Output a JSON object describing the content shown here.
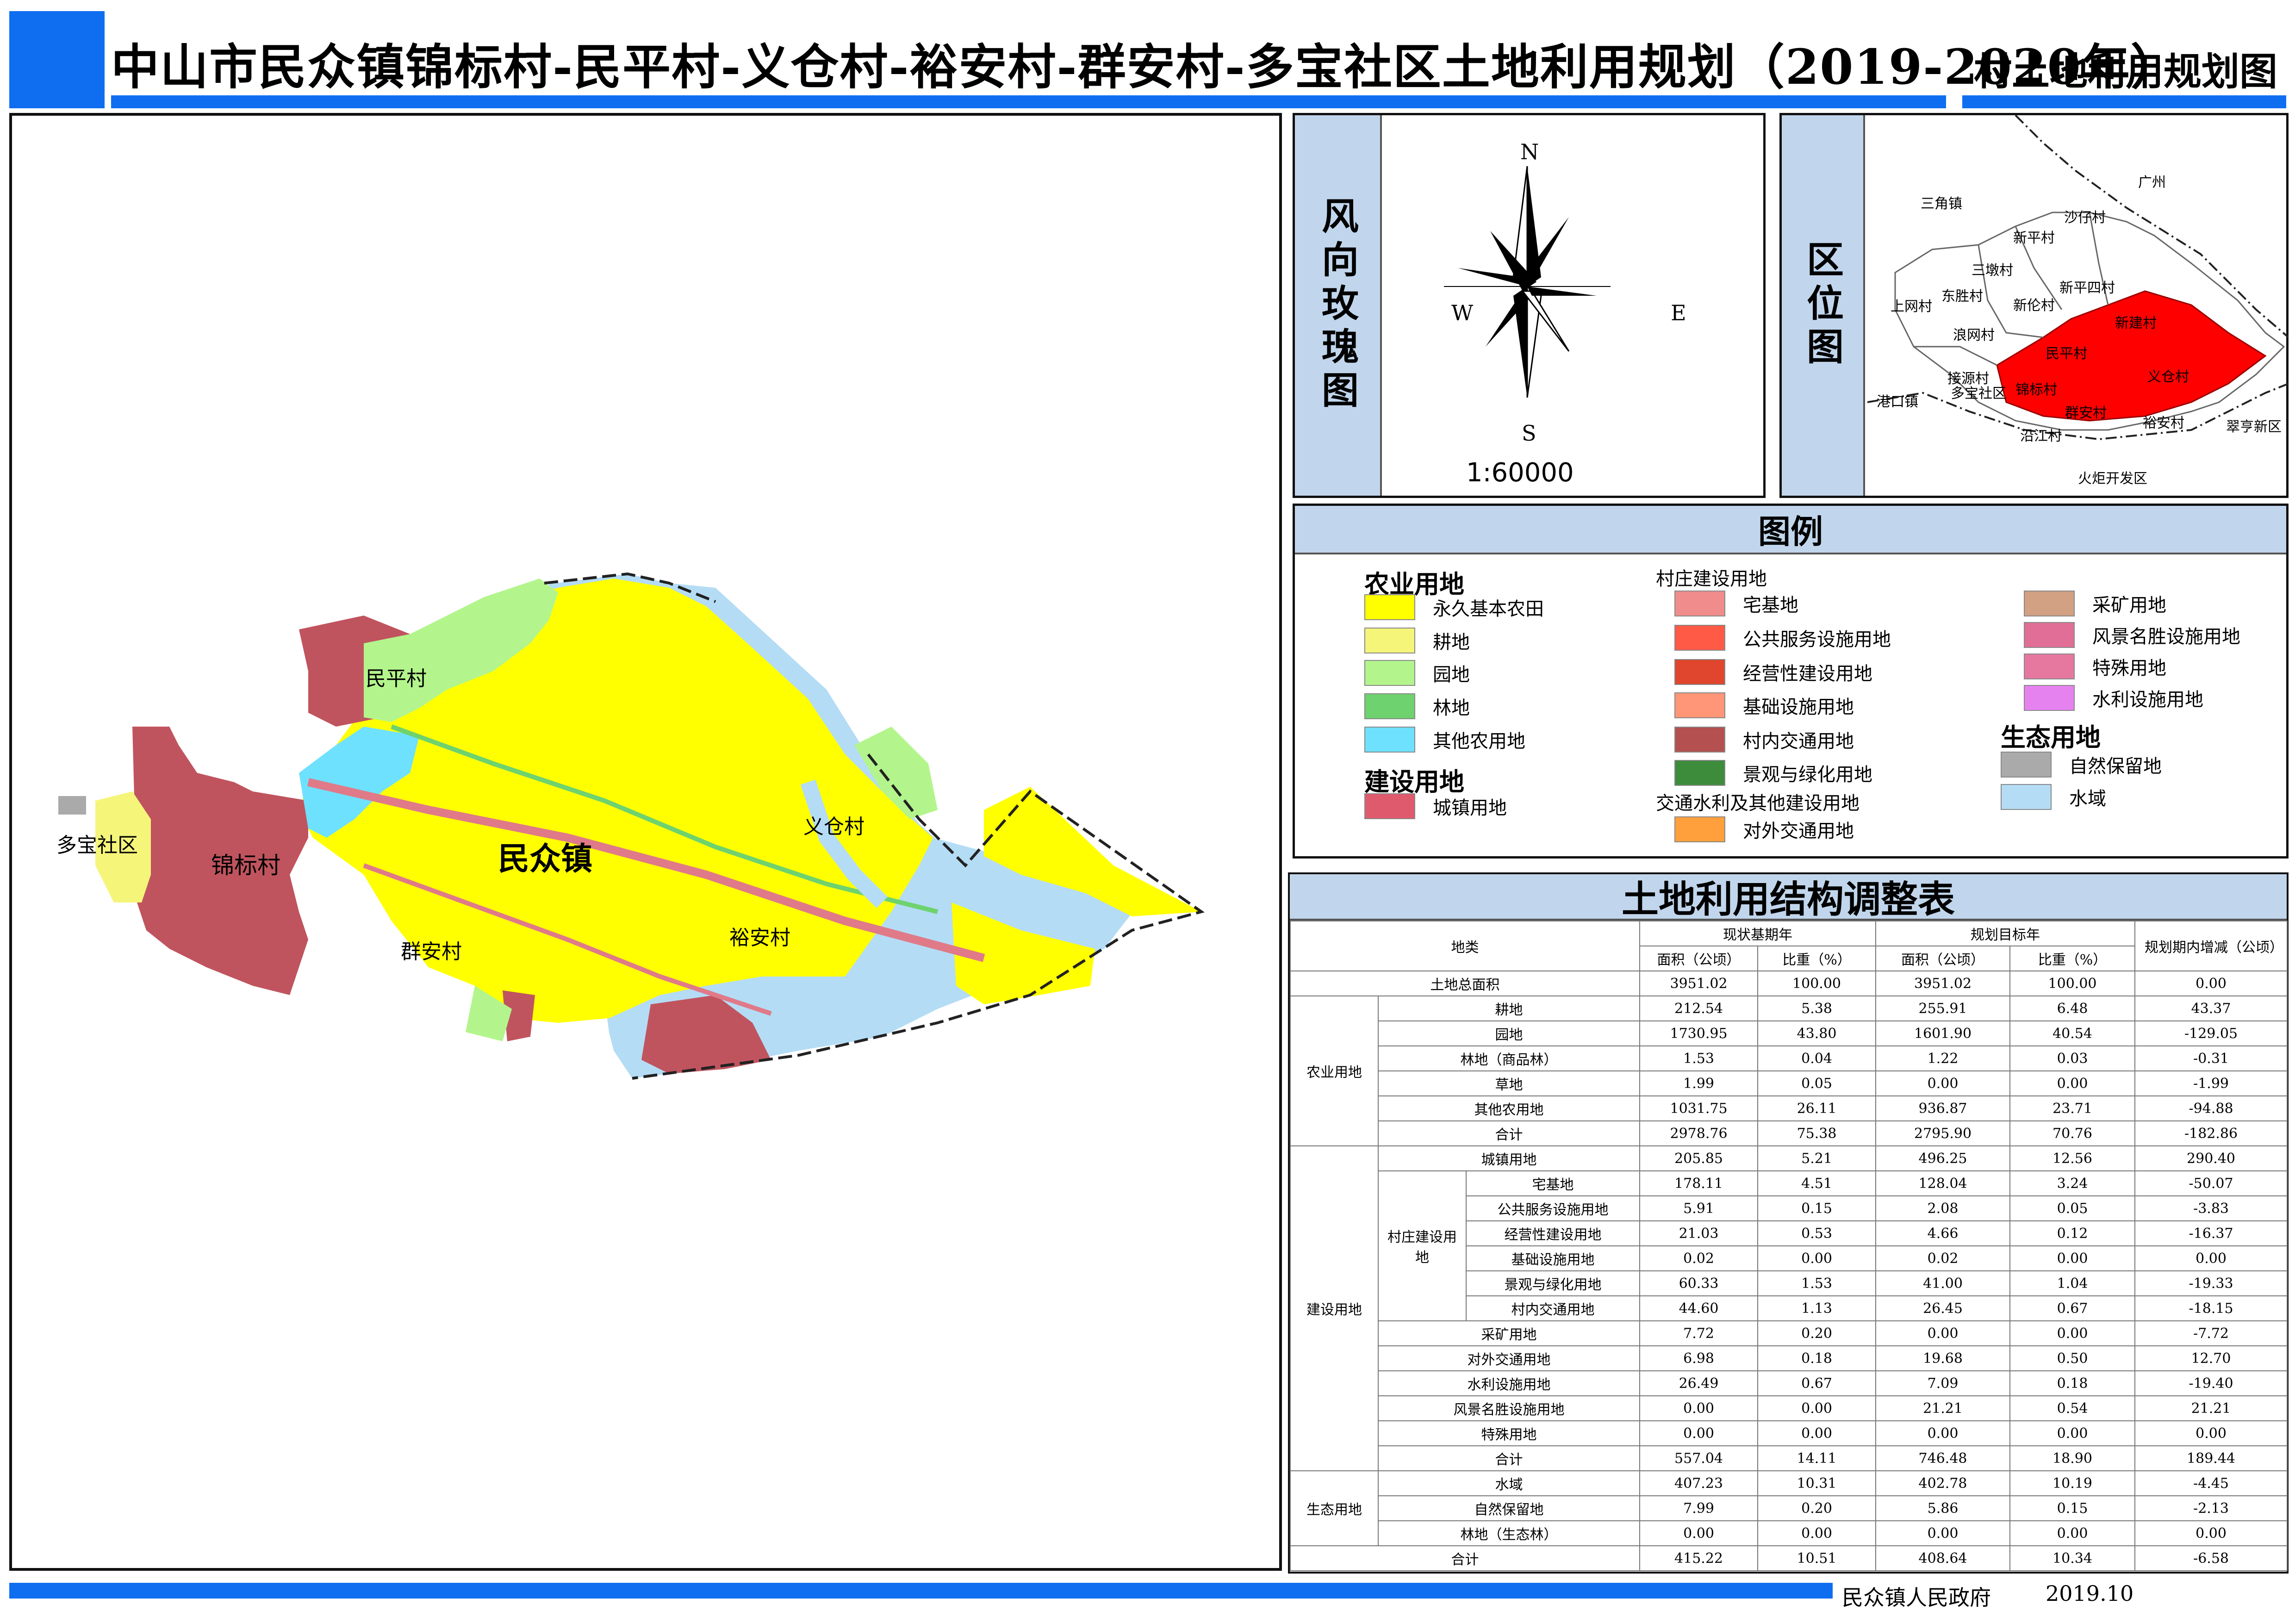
{
  "title": {
    "main": "中山市民众镇锦标村-民平村-义仓村-裕安村-群安村-多宝社区土地利用规划（2019-2020年）",
    "side": "村土地利用规划图"
  },
  "map": {
    "labels": {
      "minping": "民平村",
      "duobao": "多宝社区",
      "jinbiao": "锦标村",
      "minzhong": "民众镇",
      "yicang": "义仓村",
      "qunan": "群安村",
      "yuan": "裕安村"
    }
  },
  "compass": {
    "label": "风向玫瑰图",
    "n": "N",
    "s": "S",
    "e": "E",
    "w": "W",
    "scale": "1:60000"
  },
  "location": {
    "label": "区位图",
    "places": {
      "guangzhou": "广州",
      "sanjiao": "三角镇",
      "shazai": "沙仔村",
      "xinping": "新平村",
      "sandun": "三墩村",
      "xinpingsi": "新平四村",
      "dongsheng": "东胜村",
      "shangwang": "上网村",
      "xinlun": "新伦村",
      "xinjian": "新建村",
      "langwang": "浪网村",
      "minping": "民平村",
      "yicang": "义仓村",
      "jieyuan": "接源村",
      "duobao": "多宝社区",
      "jinbiao": "锦标村",
      "gangkou": "港口镇",
      "qunan": "群安村",
      "yuan": "裕安村",
      "cuiheng": "翠亨新区",
      "yanjiang": "沿江村",
      "huoju": "火炬开发区"
    },
    "colors": {
      "highlight": "#ff0000"
    }
  },
  "legend": {
    "title": "图例",
    "groups": {
      "agri": "农业用地",
      "village": "村庄建设用地",
      "construction": "建设用地",
      "transport": "交通水利及其他建设用地",
      "eco": "生态用地"
    },
    "items": {
      "basic_farm": {
        "label": "永久基本农田",
        "color": "#ffff00"
      },
      "farmland": {
        "label": "耕地",
        "color": "#f5f57a"
      },
      "garden": {
        "label": "园地",
        "color": "#b3f58c"
      },
      "forest": {
        "label": "林地",
        "color": "#6ed26e"
      },
      "other_agri": {
        "label": "其他农用地",
        "color": "#6ee1ff"
      },
      "urban": {
        "label": "城镇用地",
        "color": "#e05a6e"
      },
      "homestead": {
        "label": "宅基地",
        "color": "#f08c8c"
      },
      "public": {
        "label": "公共服务设施用地",
        "color": "#ff5a46"
      },
      "business": {
        "label": "经营性建设用地",
        "color": "#e0462d"
      },
      "infra": {
        "label": "基础设施用地",
        "color": "#ff9678"
      },
      "village_road": {
        "label": "村内交通用地",
        "color": "#b45050"
      },
      "landscape": {
        "label": "景观与绿化用地",
        "color": "#3c8c3c"
      },
      "external": {
        "label": "对外交通用地",
        "color": "#ffa03c"
      },
      "mining": {
        "label": "采矿用地",
        "color": "#d2a082"
      },
      "scenic": {
        "label": "风景名胜设施用地",
        "color": "#e16e96"
      },
      "special": {
        "label": "特殊用地",
        "color": "#e678a0"
      },
      "water_fac": {
        "label": "水利设施用地",
        "color": "#e682f0"
      },
      "reserve": {
        "label": "自然保留地",
        "color": "#aaaaaa"
      },
      "water": {
        "label": "水域",
        "color": "#b4dcf5"
      }
    }
  },
  "table": {
    "title": "土地利用结构调整表",
    "headers": {
      "category": "地类",
      "current": "现状基期年",
      "target": "规划目标年",
      "change": "规划期内增减（公顷）",
      "area": "面积（公顷）",
      "ratio": "比重（%）"
    },
    "groups": {
      "agri": "农业用地",
      "construction": "建设用地",
      "village": "村庄建设用地",
      "eco": "生态用地"
    },
    "rows": [
      [
        "土地总面积",
        "3951.02",
        "100.00",
        "3951.02",
        "100.00",
        "0.00"
      ],
      [
        "耕地",
        "212.54",
        "5.38",
        "255.91",
        "6.48",
        "43.37"
      ],
      [
        "园地",
        "1730.95",
        "43.80",
        "1601.90",
        "40.54",
        "-129.05"
      ],
      [
        "林地（商品林）",
        "1.53",
        "0.04",
        "1.22",
        "0.03",
        "-0.31"
      ],
      [
        "草地",
        "1.99",
        "0.05",
        "0.00",
        "0.00",
        "-1.99"
      ],
      [
        "其他农用地",
        "1031.75",
        "26.11",
        "936.87",
        "23.71",
        "-94.88"
      ],
      [
        "合计",
        "2978.76",
        "75.38",
        "2795.90",
        "70.76",
        "-182.86"
      ],
      [
        "城镇用地",
        "205.85",
        "5.21",
        "496.25",
        "12.56",
        "290.40"
      ],
      [
        "宅基地",
        "178.11",
        "4.51",
        "128.04",
        "3.24",
        "-50.07"
      ],
      [
        "公共服务设施用地",
        "5.91",
        "0.15",
        "2.08",
        "0.05",
        "-3.83"
      ],
      [
        "经营性建设用地",
        "21.03",
        "0.53",
        "4.66",
        "0.12",
        "-16.37"
      ],
      [
        "基础设施用地",
        "0.02",
        "0.00",
        "0.02",
        "0.00",
        "0.00"
      ],
      [
        "景观与绿化用地",
        "60.33",
        "1.53",
        "41.00",
        "1.04",
        "-19.33"
      ],
      [
        "村内交通用地",
        "44.60",
        "1.13",
        "26.45",
        "0.67",
        "-18.15"
      ],
      [
        "采矿用地",
        "7.72",
        "0.20",
        "0.00",
        "0.00",
        "-7.72"
      ],
      [
        "对外交通用地",
        "6.98",
        "0.18",
        "19.68",
        "0.50",
        "12.70"
      ],
      [
        "水利设施用地",
        "26.49",
        "0.67",
        "7.09",
        "0.18",
        "-19.40"
      ],
      [
        "风景名胜设施用地",
        "0.00",
        "0.00",
        "21.21",
        "0.54",
        "21.21"
      ],
      [
        "特殊用地",
        "0.00",
        "0.00",
        "0.00",
        "0.00",
        "0.00"
      ],
      [
        "合计",
        "557.04",
        "14.11",
        "746.48",
        "18.90",
        "189.44"
      ],
      [
        "水域",
        "407.23",
        "10.31",
        "402.78",
        "10.19",
        "-4.45"
      ],
      [
        "自然保留地",
        "7.99",
        "0.20",
        "5.86",
        "0.15",
        "-2.13"
      ],
      [
        "林地（生态林）",
        "0.00",
        "0.00",
        "0.00",
        "0.00",
        "0.00"
      ],
      [
        "合计",
        "415.22",
        "10.51",
        "408.64",
        "10.34",
        "-6.58"
      ]
    ]
  },
  "footer": {
    "org": "民众镇人民政府",
    "date": "2019.10"
  },
  "colors": {
    "accent": "#0f6ef0",
    "panel_header": "#c1d6ec"
  }
}
